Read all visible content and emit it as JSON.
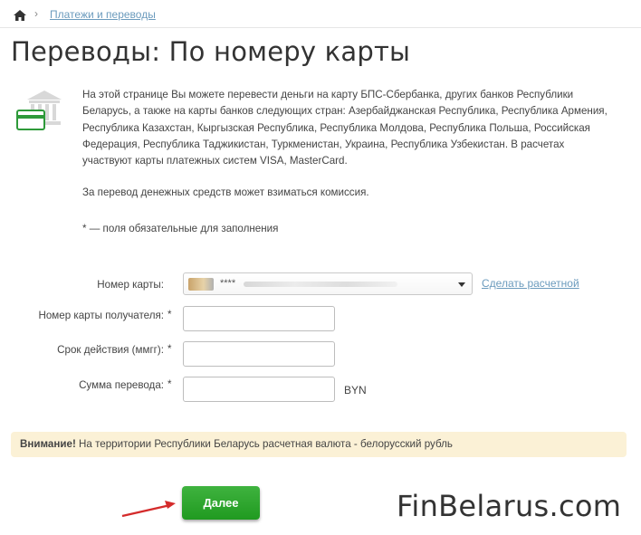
{
  "breadcrumb": {
    "home_icon": "home-icon",
    "separator": "›",
    "link": "Платежи и переводы"
  },
  "page": {
    "title": "Переводы: По номеру карты",
    "icon": "bank-card-icon"
  },
  "description": {
    "paragraph1": "На этой странице Вы можете перевести деньги на карту БПС-Сбербанка, других банков Республики Беларусь, а также на карты банков следующих стран: Азербайджанская Республика, Республика Армения, Республика Казахстан, Кыргызская Республика, Республика Молдова, Республика Польша, Российская Федерация, Республика Таджикистан, Туркменистан, Украина, Республика Узбекистан. В расчетах участвуют карты платежных систем VISA, MasterCard.",
    "paragraph2": "За перевод денежных средств может взиматься комиссия.",
    "paragraph3": "* — поля обязательные для заполнения"
  },
  "form": {
    "card_label": "Номер карты:",
    "card_value_mask": "****",
    "make_default_link": "Сделать расчетной",
    "recipient_label": "Номер карты получателя:",
    "expiry_label": "Срок действия (ммгг):",
    "amount_label": "Сумма перевода:",
    "required_mark": "*",
    "currency": "BYN",
    "recipient_value": "",
    "expiry_value": "",
    "amount_value": ""
  },
  "warning": {
    "bold": "Внимание!",
    "text": " На территории Республики Беларусь расчетная валюта - белорусский рубль"
  },
  "submit": {
    "label": "Далее"
  },
  "watermark": "FinBelarus.com",
  "colors": {
    "link": "#6b9bbd",
    "button": "#2ea82e",
    "warning_bg": "#fbf1d6",
    "arrow": "#d42b2b"
  }
}
